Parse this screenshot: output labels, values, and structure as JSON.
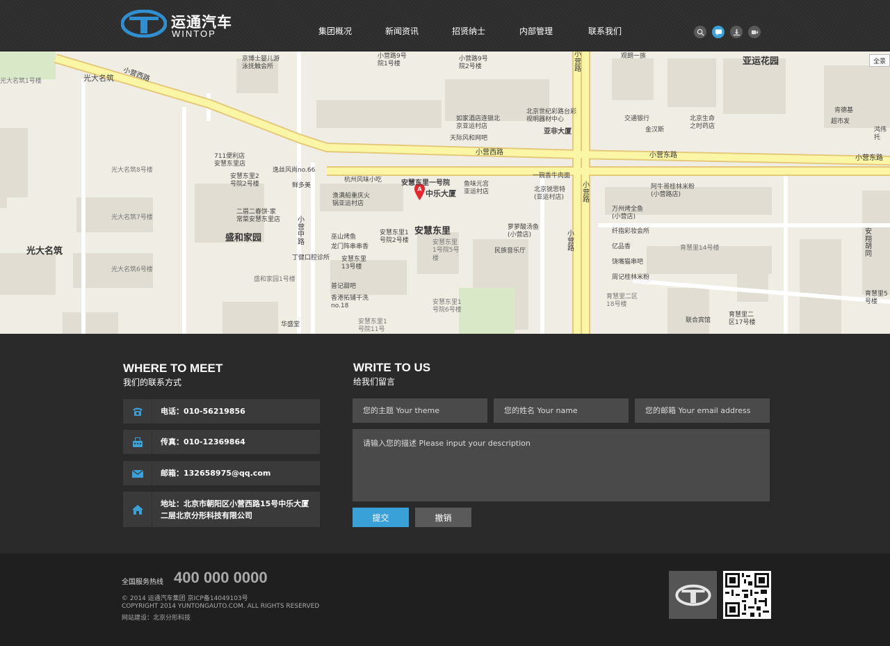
{
  "header": {
    "logo_cn": "运通汽车",
    "logo_en": "WINTOP",
    "nav": [
      {
        "label": "集团概况"
      },
      {
        "label": "新闻资讯"
      },
      {
        "label": "招贤纳士"
      },
      {
        "label": "内部管理"
      },
      {
        "label": "联系我们"
      }
    ],
    "icons": [
      "search-icon",
      "message-icon",
      "download-icon",
      "video-icon"
    ],
    "accent": "#3aa0d8"
  },
  "map": {
    "fullscreen_label": "全景",
    "marker_letter": "A",
    "labels": {
      "guangda_top": "光大名筑",
      "guangda": "光大名筑",
      "shenghe": "盛和家园",
      "anhui": "安慧东里",
      "yayun": "亚运花园",
      "yafei": "亚非大厦",
      "zhongle": "中乐大厦",
      "anhui_yihao": "安慧东里一号院",
      "xiaoying_xi_1": "小营西路",
      "xiaoying_xi_2": "小营西路",
      "xiaoying_dong_1": "小营东路",
      "xiaoying_dong_2": "小营东路",
      "xiaoying_v1": "小营路",
      "xiaoying_v2": "小营路",
      "xiaoyingzhong_v": "小营中路",
      "anxiang_v": "安翔胡同",
      "p1": "京博士婴儿游泳抚触会所",
      "p2": "小营路9号院1号楼",
      "p3": "小营路9号院2号楼",
      "p4": "观朗一族",
      "p5": "北京世纪彩路台彩视明器材中心",
      "p6": "如家酒店连锁北京亚运村店",
      "p7": "天际风和网吧",
      "p8": "交通银行",
      "p9": "金汉斯",
      "p10": "北京生命之时药店",
      "p11": "肯德基",
      "p12": "711便利店安慧东里店",
      "p13": "逸丝风尚no.66",
      "p14": "杭州风味小吃",
      "p15": "鱼味元宫亚运村店",
      "p16": "一碗香牛肉面",
      "p17": "北京锐思特(亚运村店)",
      "p18": "阿牛哥桂林米粉(小营路店)",
      "p19": "安慧东里2号院2号楼",
      "p20": "鲜多美",
      "p21": "渔满船重庆火锅亚运村店",
      "p22": "二眉二春饼·家常菜安慧东里店",
      "p23": "萝萝酸汤鱼(小营店)",
      "p24": "万州烤全鱼(小营店)",
      "p25": "纤指彩妆会所",
      "p26": "亿品香",
      "p27": "饶嘴猫串吧",
      "p28": "周记桂林米粉",
      "p29": "巫山烤鱼",
      "p30": "龙门阵串串香",
      "p31": "安慧东里1号院2号楼",
      "p32": "安慧东里1号院5号楼",
      "p33": "民族音乐厅",
      "p34": "丁健口腔诊所",
      "p35": "安慧东里13号楼",
      "p36": "普记甜吧",
      "p37": "香港拓铺干洗no.18",
      "p38": "安慧东里1号院6号楼",
      "p39": "安慧东里1号院11号楼",
      "p40": "华盛堂",
      "p41": "盛和家园1号楼",
      "p42": "育慧里14号楼",
      "p43": "育慧里二区18号楼",
      "p44": "联合宾馆",
      "p45": "育慧里二区17号楼",
      "p46": "育慧里5号楼",
      "p47": "光大名筑8号楼",
      "p48": "光大名筑7号楼",
      "p49": "光大名筑6号楼",
      "p50": "光大名筑1号楼",
      "p51": "超市发",
      "p52": "鸿伟托"
    }
  },
  "contact": {
    "meet_title": "WHERE TO MEET",
    "meet_sub": "我们的联系方式",
    "write_title": "WRITE TO US",
    "write_sub": "给我们留言",
    "phone": "电话：010-56219856",
    "fax": "传真：010-12369864",
    "email": "邮箱：132658975@qq.com",
    "address": "地址：北京市朝阳区小营西路15号中乐大厦二层北京分形科技有限公司",
    "form": {
      "theme_placeholder": "您的主题 Your theme",
      "name_placeholder": "您的姓名 Your name",
      "email_placeholder": "您的邮箱 Your email address",
      "desc_placeholder": "请输入您的描述 Please input your description",
      "submit": "提交",
      "cancel": "撤销"
    }
  },
  "footer": {
    "hotline_label": "全国服务热线",
    "hotline": "400 000 0000",
    "copyright_cn": "© 2014 运通汽车集团  京ICP备14049103号",
    "copyright_en": "COPYRIGHT 2014 YUNTONGAUTO.COM. ALL RIGHTS RESERVED",
    "builder": "网站建设：北京分形科技"
  }
}
